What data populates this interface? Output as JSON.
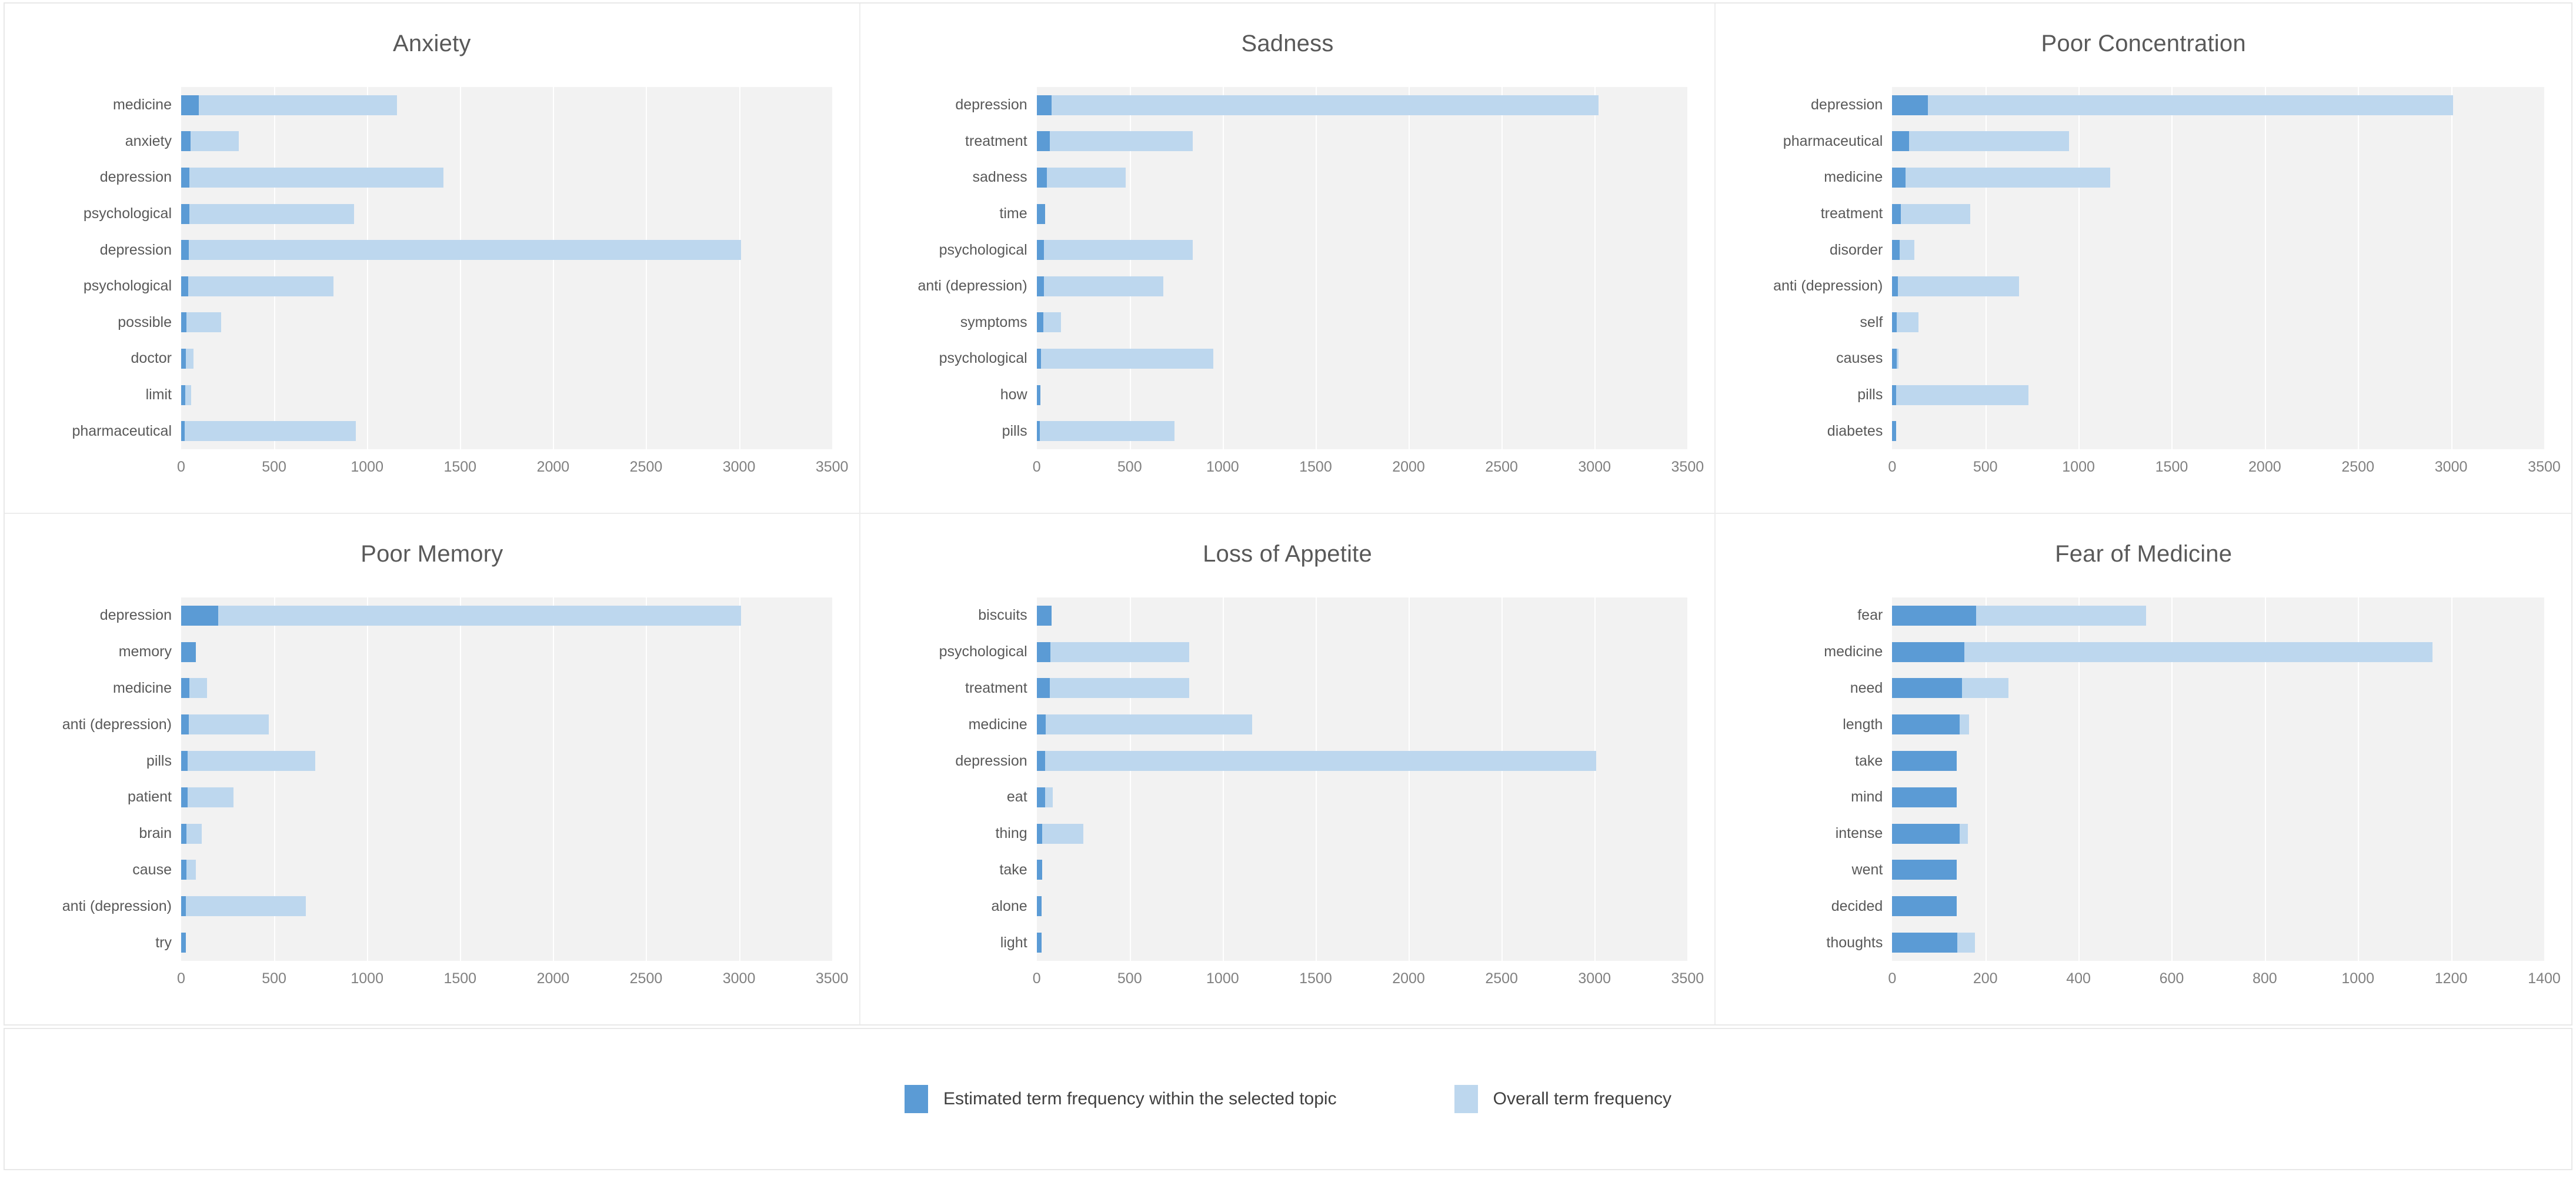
{
  "colors": {
    "estimated_bar": "#5B9BD5",
    "overall_bar": "#BDD7EE",
    "plot_background": "#F2F2F2",
    "title_text": "#595959",
    "panel_border": "#E8E8E8"
  },
  "legend": {
    "items": [
      {
        "label": "Estimated term frequency within the selected topic",
        "color": "#5B9BD5",
        "swatch": "dark"
      },
      {
        "label": "Overall term frequency",
        "color": "#BDD7EE",
        "swatch": "light"
      }
    ]
  },
  "chart_data": [
    {
      "type": "bar",
      "orientation": "horizontal",
      "title": "Anxiety",
      "xlabel": "",
      "ylabel": "",
      "xlim": [
        0,
        3500
      ],
      "xticks": [
        0,
        500,
        1000,
        1500,
        2000,
        2500,
        3000,
        3500
      ],
      "grid": true,
      "legend_position": "bottom",
      "categories": [
        "medicine",
        "anxiety",
        "depression",
        "psychological",
        "depression",
        "psychological",
        "possible",
        "doctor",
        "limit",
        "pharmaceutical"
      ],
      "series": [
        {
          "name": "Estimated term frequency within the selected topic",
          "values": [
            95,
            50,
            45,
            45,
            40,
            38,
            30,
            25,
            22,
            20
          ]
        },
        {
          "name": "Overall term frequency",
          "values": [
            1160,
            310,
            1410,
            930,
            3010,
            820,
            215,
            65,
            55,
            940
          ]
        }
      ]
    },
    {
      "type": "bar",
      "orientation": "horizontal",
      "title": "Sadness",
      "xlabel": "",
      "ylabel": "",
      "xlim": [
        0,
        3500
      ],
      "xticks": [
        0,
        500,
        1000,
        1500,
        2000,
        2500,
        3000,
        3500
      ],
      "grid": true,
      "legend_position": "bottom",
      "categories": [
        "depression",
        "treatment",
        "sadness",
        "time",
        "psychological",
        "anti (depression)",
        "symptoms",
        "psychological",
        "how",
        "pills"
      ],
      "series": [
        {
          "name": "Estimated term frequency within the selected topic",
          "values": [
            80,
            70,
            55,
            45,
            40,
            38,
            35,
            22,
            20,
            18
          ]
        },
        {
          "name": "Overall term frequency",
          "values": [
            3020,
            840,
            480,
            45,
            840,
            680,
            130,
            950,
            20,
            740
          ]
        }
      ]
    },
    {
      "type": "bar",
      "orientation": "horizontal",
      "title": "Poor Concentration",
      "xlabel": "",
      "ylabel": "",
      "xlim": [
        0,
        3500
      ],
      "xticks": [
        0,
        500,
        1000,
        1500,
        2000,
        2500,
        3000,
        3500
      ],
      "grid": true,
      "legend_position": "bottom",
      "categories": [
        "depression",
        "pharmaceutical",
        "medicine",
        "treatment",
        "disorder",
        "anti (depression)",
        "self",
        "causes",
        "pills",
        "diabetes"
      ],
      "series": [
        {
          "name": "Estimated term frequency within the selected topic",
          "values": [
            190,
            90,
            70,
            45,
            40,
            30,
            25,
            25,
            22,
            20
          ]
        },
        {
          "name": "Overall term frequency",
          "values": [
            3010,
            950,
            1170,
            420,
            120,
            680,
            140,
            35,
            730,
            20
          ]
        }
      ]
    },
    {
      "type": "bar",
      "orientation": "horizontal",
      "title": "Poor Memory",
      "xlabel": "",
      "ylabel": "",
      "xlim": [
        0,
        3500
      ],
      "xticks": [
        0,
        500,
        1000,
        1500,
        2000,
        2500,
        3000,
        3500
      ],
      "grid": true,
      "legend_position": "bottom",
      "categories": [
        "depression",
        "memory",
        "medicine",
        "anti (depression)",
        "pills",
        "patient",
        "brain",
        "cause",
        "anti (depression)",
        "try"
      ],
      "series": [
        {
          "name": "Estimated term frequency within the selected topic",
          "values": [
            200,
            80,
            45,
            40,
            35,
            35,
            30,
            30,
            25,
            25
          ]
        },
        {
          "name": "Overall term frequency",
          "values": [
            3010,
            80,
            140,
            470,
            720,
            280,
            110,
            80,
            670,
            25
          ]
        }
      ]
    },
    {
      "type": "bar",
      "orientation": "horizontal",
      "title": "Loss of Appetite",
      "xlabel": "",
      "ylabel": "",
      "xlim": [
        0,
        3500
      ],
      "xticks": [
        0,
        500,
        1000,
        1500,
        2000,
        2500,
        3000,
        3500
      ],
      "grid": true,
      "legend_position": "bottom",
      "categories": [
        "biscuits",
        "psychological",
        "treatment",
        "medicine",
        "depression",
        "eat",
        "thing",
        "take",
        "alone",
        "light"
      ],
      "series": [
        {
          "name": "Estimated term frequency within the selected topic",
          "values": [
            80,
            75,
            70,
            50,
            45,
            45,
            30,
            28,
            25,
            25
          ]
        },
        {
          "name": "Overall term frequency",
          "values": [
            80,
            820,
            820,
            1160,
            3010,
            85,
            250,
            28,
            25,
            25
          ]
        }
      ]
    },
    {
      "type": "bar",
      "orientation": "horizontal",
      "title": "Fear of Medicine",
      "xlabel": "",
      "ylabel": "",
      "xlim": [
        0,
        1400
      ],
      "xticks": [
        0,
        200,
        400,
        600,
        800,
        1000,
        1200,
        1400
      ],
      "grid": true,
      "legend_position": "bottom",
      "categories": [
        "fear",
        "medicine",
        "need",
        "length",
        "take",
        "mind",
        "intense",
        "went",
        "decided",
        "thoughts"
      ],
      "series": [
        {
          "name": "Estimated term frequency within the selected topic",
          "values": [
            180,
            155,
            150,
            145,
            138,
            138,
            145,
            138,
            138,
            140
          ]
        },
        {
          "name": "Overall term frequency",
          "values": [
            545,
            1160,
            250,
            165,
            138,
            138,
            162,
            138,
            138,
            178
          ]
        }
      ]
    }
  ]
}
